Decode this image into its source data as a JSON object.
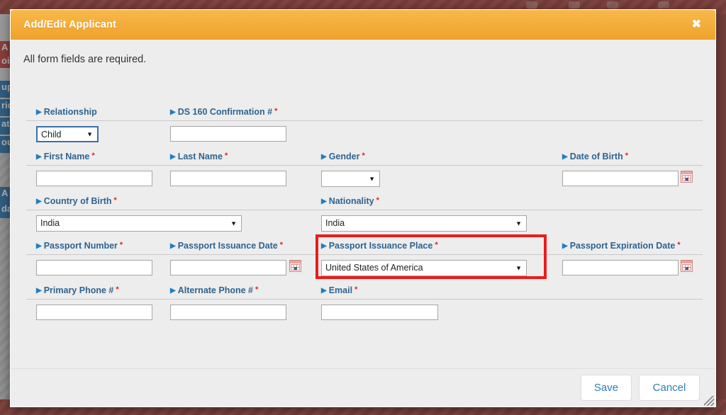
{
  "background": {
    "left_items": [
      {
        "text": "A",
        "style": "red"
      },
      {
        "text": "oi",
        "style": "red"
      },
      {
        "text": "up",
        "style": "blue"
      },
      {
        "text": "ric",
        "style": "blue"
      },
      {
        "text": "at",
        "style": "blue"
      },
      {
        "text": "ou",
        "style": "blue"
      },
      {
        "text": "",
        "style": "hatch"
      },
      {
        "text": "A",
        "style": "blue"
      },
      {
        "text": "da",
        "style": "blue"
      }
    ]
  },
  "modal": {
    "title": "Add/Edit Applicant",
    "close_label": "✖",
    "required_note": "All form fields are required.",
    "footer": {
      "save_label": "Save",
      "cancel_label": "Cancel"
    }
  },
  "form": {
    "rows": [
      {
        "fields": [
          {
            "label": "Relationship",
            "required": false,
            "type": "select",
            "value": "Child",
            "focused": true
          },
          {
            "label": "DS 160 Confirmation #",
            "required": true,
            "type": "text",
            "value": ""
          }
        ]
      },
      {
        "fields": [
          {
            "label": "First Name",
            "required": true,
            "type": "text",
            "value": ""
          },
          {
            "label": "Last Name",
            "required": true,
            "type": "text",
            "value": ""
          },
          {
            "label": "Gender",
            "required": true,
            "type": "select",
            "value": ""
          },
          {
            "label": "Date of Birth",
            "required": true,
            "type": "date",
            "value": ""
          }
        ]
      },
      {
        "fields": [
          {
            "label": "Country of Birth",
            "required": true,
            "type": "select",
            "value": "India"
          },
          {
            "label": "Nationality",
            "required": true,
            "type": "select",
            "value": "India"
          }
        ]
      },
      {
        "fields": [
          {
            "label": "Passport Number",
            "required": true,
            "type": "text",
            "value": ""
          },
          {
            "label": "Passport Issuance Date",
            "required": true,
            "type": "date",
            "value": ""
          },
          {
            "label": "Passport Issuance Place",
            "required": true,
            "type": "select",
            "value": "United States of America",
            "highlighted": true
          },
          {
            "label": "Passport Expiration Date",
            "required": true,
            "type": "date",
            "value": ""
          }
        ]
      },
      {
        "fields": [
          {
            "label": "Primary Phone #",
            "required": true,
            "type": "text",
            "value": ""
          },
          {
            "label": "Alternate Phone #",
            "required": true,
            "type": "text",
            "value": ""
          },
          {
            "label": "Email",
            "required": true,
            "type": "text",
            "value": ""
          }
        ]
      }
    ]
  },
  "colors": {
    "header_orange": "#f4ad3a",
    "label_blue": "#2d6491",
    "required_red": "#e41f1f",
    "annotation_red": "#ec1c1c",
    "button_blue": "#2b7eb5",
    "body_gray": "#ededed"
  },
  "icons": {
    "triangle": "▶",
    "caret_down": "▼",
    "asterisk": "*"
  }
}
